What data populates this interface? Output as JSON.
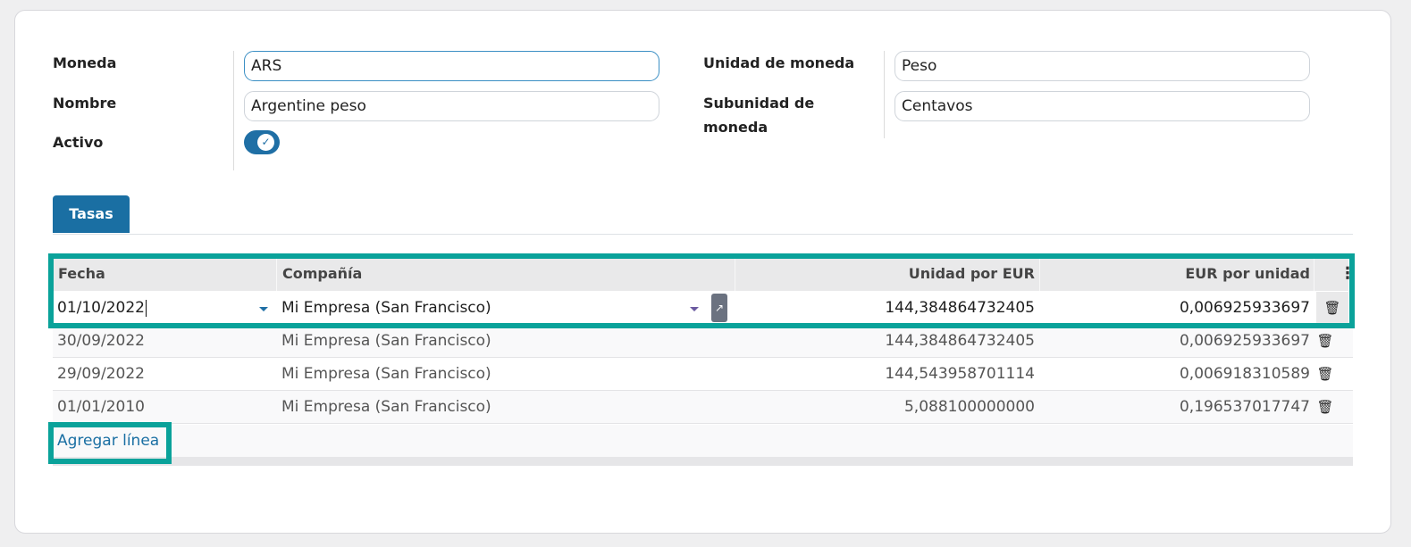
{
  "form": {
    "moneda_label": "Moneda",
    "moneda_value": "ARS",
    "nombre_label": "Nombre",
    "nombre_value": "Argentine peso",
    "activo_label": "Activo",
    "activo_checked": true,
    "unidad_label": "Unidad de moneda",
    "unidad_value": "Peso",
    "subunidad_label_line1": "Subunidad de",
    "subunidad_label_line2": "moneda",
    "subunidad_value": "Centavos"
  },
  "tabs": [
    {
      "label": "Tasas",
      "active": true
    }
  ],
  "table": {
    "columns": [
      "Fecha",
      "Compañía",
      "Unidad por EUR",
      "EUR por unidad"
    ],
    "rows": [
      {
        "fecha": "01/10/2022",
        "compania": "Mi Empresa (San Francisco)",
        "unidad_por_eur": "144,384864732405",
        "eur_por_unidad": "0,006925933697",
        "editing": true
      },
      {
        "fecha": "30/09/2022",
        "compania": "Mi Empresa (San Francisco)",
        "unidad_por_eur": "144,384864732405",
        "eur_por_unidad": "0,006925933697"
      },
      {
        "fecha": "29/09/2022",
        "compania": "Mi Empresa (San Francisco)",
        "unidad_por_eur": "144,543958701114",
        "eur_por_unidad": "0,006918310589"
      },
      {
        "fecha": "01/01/2010",
        "compania": "Mi Empresa (San Francisco)",
        "unidad_por_eur": "5,088100000000",
        "eur_por_unidad": "0,196537017747"
      }
    ],
    "add_line_label": "Agregar línea"
  },
  "icons": {
    "toggle_check": "check-icon",
    "delete": "trash-icon",
    "external": "external-link-icon",
    "dropdown": "caret-down-icon",
    "options": "kebab-menu-icon"
  },
  "colors": {
    "accent": "#1a6fa3",
    "highlight": "#0aa29a",
    "header_bg": "#e9e9ea"
  }
}
